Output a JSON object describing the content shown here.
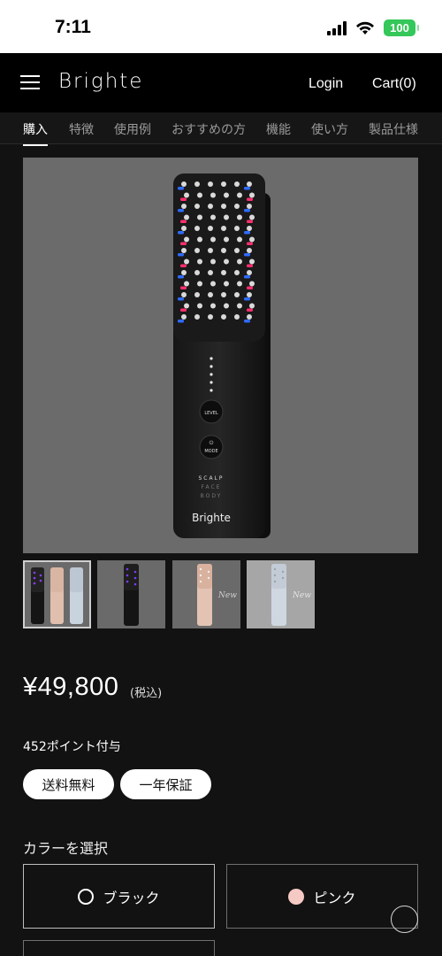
{
  "status_bar": {
    "time": "7:11",
    "battery": "100"
  },
  "header": {
    "logo": "Brighte",
    "login": "Login",
    "cart": "Cart(0)"
  },
  "tabs": [
    {
      "label": "購入",
      "active": true
    },
    {
      "label": "特徴"
    },
    {
      "label": "使用例"
    },
    {
      "label": "おすすめの方"
    },
    {
      "label": "機能"
    },
    {
      "label": "使い方"
    },
    {
      "label": "製品仕様"
    }
  ],
  "product_image": {
    "device_labels": {
      "level": "LEVEL",
      "mode": "MODE",
      "scalp": "SCALP",
      "face": "FACE",
      "body": "BODY",
      "brand": "Brighte"
    }
  },
  "thumbnails": [
    {
      "name": "three-colors",
      "selected": true
    },
    {
      "name": "black"
    },
    {
      "name": "pink",
      "tag": "New"
    },
    {
      "name": "blue",
      "tag": "New"
    }
  ],
  "price": {
    "amount": "¥49,800",
    "tax_note": "(税込)"
  },
  "points": "452ポイント付与",
  "badges": [
    "送料無料",
    "一年保証"
  ],
  "color_select": {
    "heading": "カラーを選択",
    "options": [
      {
        "label": "ブラック",
        "color": "#000000"
      },
      {
        "label": "ピンク",
        "color": "#f5c9c4"
      }
    ]
  }
}
